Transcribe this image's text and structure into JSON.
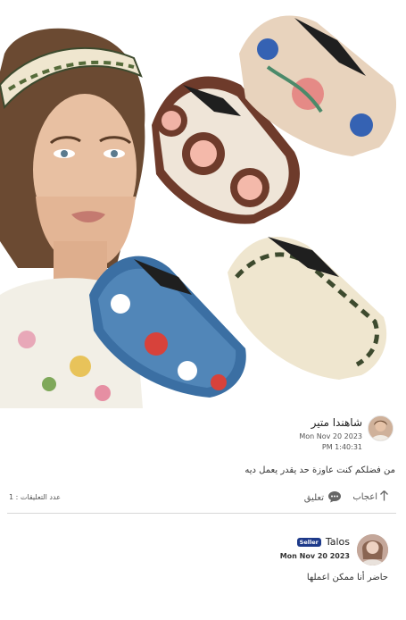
{
  "post": {
    "author_name": "شاهندا متير",
    "date": "Mon Nov 20 2023",
    "time": "PM 1:40:31",
    "text": "من فضلكم كنت عاوزة حد يقدر يعمل ديه"
  },
  "actions": {
    "like_label": "اعجاب",
    "comment_label": "تعليق",
    "comments_count": "عدد التعليقات : 1"
  },
  "reply": {
    "author_name": "Talos",
    "badge": "Seller",
    "date": "Mon Nov 20 2023",
    "text": "حاضر أنا ممكن اعملها"
  },
  "icons": {
    "like": "arrow-up-icon",
    "comment": "speech-bubble-icon"
  },
  "colors": {
    "seller_badge": "#1e3a8a",
    "divider": "#d7d7d7"
  }
}
